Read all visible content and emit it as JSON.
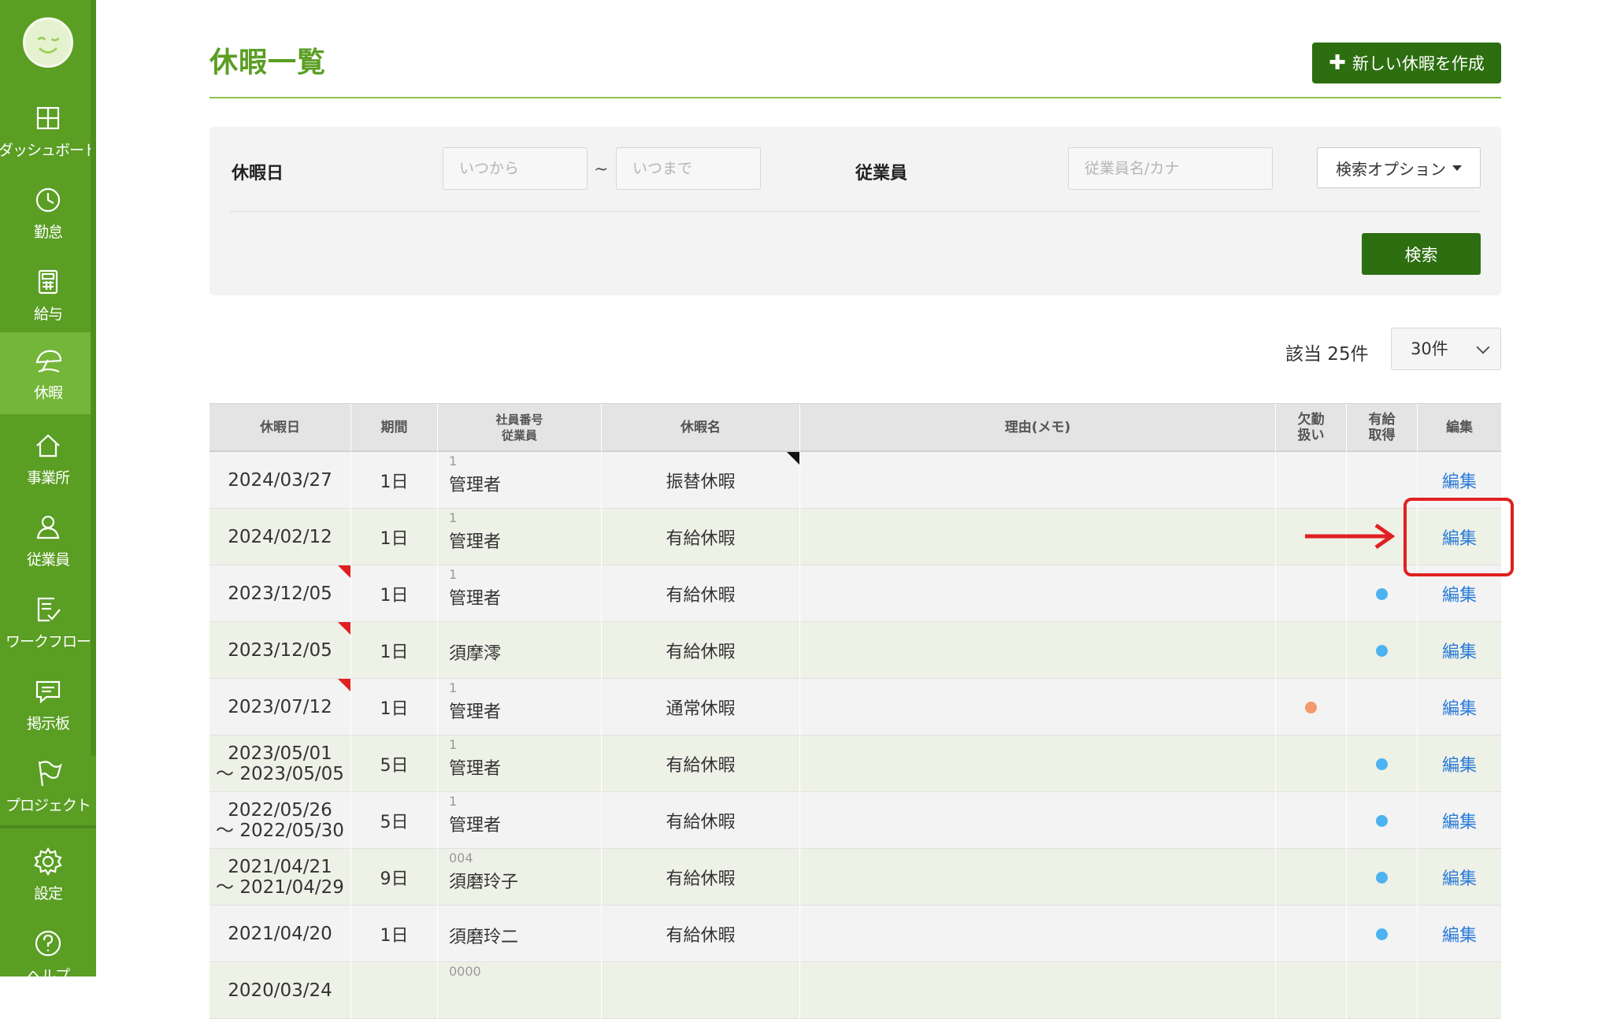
{
  "sidebar": {
    "items": [
      {
        "label": "ダッシュボード",
        "icon": "dashboard-icon"
      },
      {
        "label": "勤怠",
        "icon": "clock-icon"
      },
      {
        "label": "給与",
        "icon": "calculator-icon"
      },
      {
        "label": "休暇",
        "icon": "umbrella-icon",
        "active": true
      },
      {
        "label": "事業所",
        "icon": "home-icon"
      },
      {
        "label": "従業員",
        "icon": "person-icon"
      },
      {
        "label": "ワークフロー",
        "icon": "checklist-icon"
      },
      {
        "label": "掲示板",
        "icon": "chat-icon"
      },
      {
        "label": "プロジェクト",
        "icon": "flag-icon"
      },
      {
        "label": "設定",
        "icon": "gear-icon"
      },
      {
        "label": "ヘルプ",
        "icon": "help-icon"
      }
    ]
  },
  "header": {
    "title": "休暇一覧",
    "new_button_label": "新しい休暇を作成"
  },
  "search": {
    "date_label": "休暇日",
    "from_placeholder": "いつから",
    "tilde": "~",
    "to_placeholder": "いつまで",
    "employee_label": "従業員",
    "employee_placeholder": "従業員名/カナ",
    "options_label": "検索オプション",
    "search_button": "検索"
  },
  "results": {
    "count_text": "該当 25件",
    "per_page": "30件"
  },
  "table": {
    "headers": {
      "date": "休暇日",
      "days": "期間",
      "emp_line1": "社員番号",
      "emp_line2": "従業員",
      "type": "休暇名",
      "memo": "理由(メモ)",
      "abs_line1": "欠勤",
      "abs_line2": "扱い",
      "paid_line1": "有給",
      "paid_line2": "取得",
      "edit": "編集"
    },
    "rows": [
      {
        "date1": "2024/03/27",
        "date2": "",
        "days": "1日",
        "num": "1",
        "name": "管理者",
        "type": "振替休暇",
        "abs": false,
        "paid": false,
        "edit": "編集"
      },
      {
        "date1": "2024/02/12",
        "date2": "",
        "days": "1日",
        "num": "1",
        "name": "管理者",
        "type": "有給休暇",
        "abs": false,
        "paid": false,
        "edit": "編集"
      },
      {
        "date1": "2023/12/05",
        "date2": "",
        "days": "1日",
        "num": "1",
        "name": "管理者",
        "type": "有給休暇",
        "abs": false,
        "paid": true,
        "edit": "編集"
      },
      {
        "date1": "2023/12/05",
        "date2": "",
        "days": "1日",
        "num": "",
        "name": "須摩澪",
        "type": "有給休暇",
        "abs": false,
        "paid": true,
        "edit": "編集"
      },
      {
        "date1": "2023/07/12",
        "date2": "",
        "days": "1日",
        "num": "1",
        "name": "管理者",
        "type": "通常休暇",
        "abs": true,
        "paid": false,
        "edit": "編集"
      },
      {
        "date1": "2023/05/01",
        "date2": "～ 2023/05/05",
        "days": "5日",
        "num": "1",
        "name": "管理者",
        "type": "有給休暇",
        "abs": false,
        "paid": true,
        "edit": "編集"
      },
      {
        "date1": "2022/05/26",
        "date2": "～ 2022/05/30",
        "days": "5日",
        "num": "1",
        "name": "管理者",
        "type": "有給休暇",
        "abs": false,
        "paid": true,
        "edit": "編集"
      },
      {
        "date1": "2021/04/21",
        "date2": "～ 2021/04/29",
        "days": "9日",
        "num": "004",
        "name": "須磨玲子",
        "type": "有給休暇",
        "abs": false,
        "paid": true,
        "edit": "編集"
      },
      {
        "date1": "2021/04/20",
        "date2": "",
        "days": "1日",
        "num": "",
        "name": "須磨玲二",
        "type": "有給休暇",
        "abs": false,
        "paid": true,
        "edit": "編集"
      },
      {
        "date1": "2020/03/24",
        "date2": "",
        "days": "",
        "num": "0000",
        "name": "",
        "type": "",
        "abs": false,
        "paid": false,
        "edit": ""
      }
    ]
  },
  "colors": {
    "sidebar": "#5a9e23",
    "sidebar_active": "#74b639",
    "primary_button": "#2d6e10",
    "title": "#5a9e23",
    "link": "#2a7bd8",
    "paid_dot": "#4db3f0",
    "absence_dot": "#f3996b",
    "annotation": "#e02020"
  }
}
